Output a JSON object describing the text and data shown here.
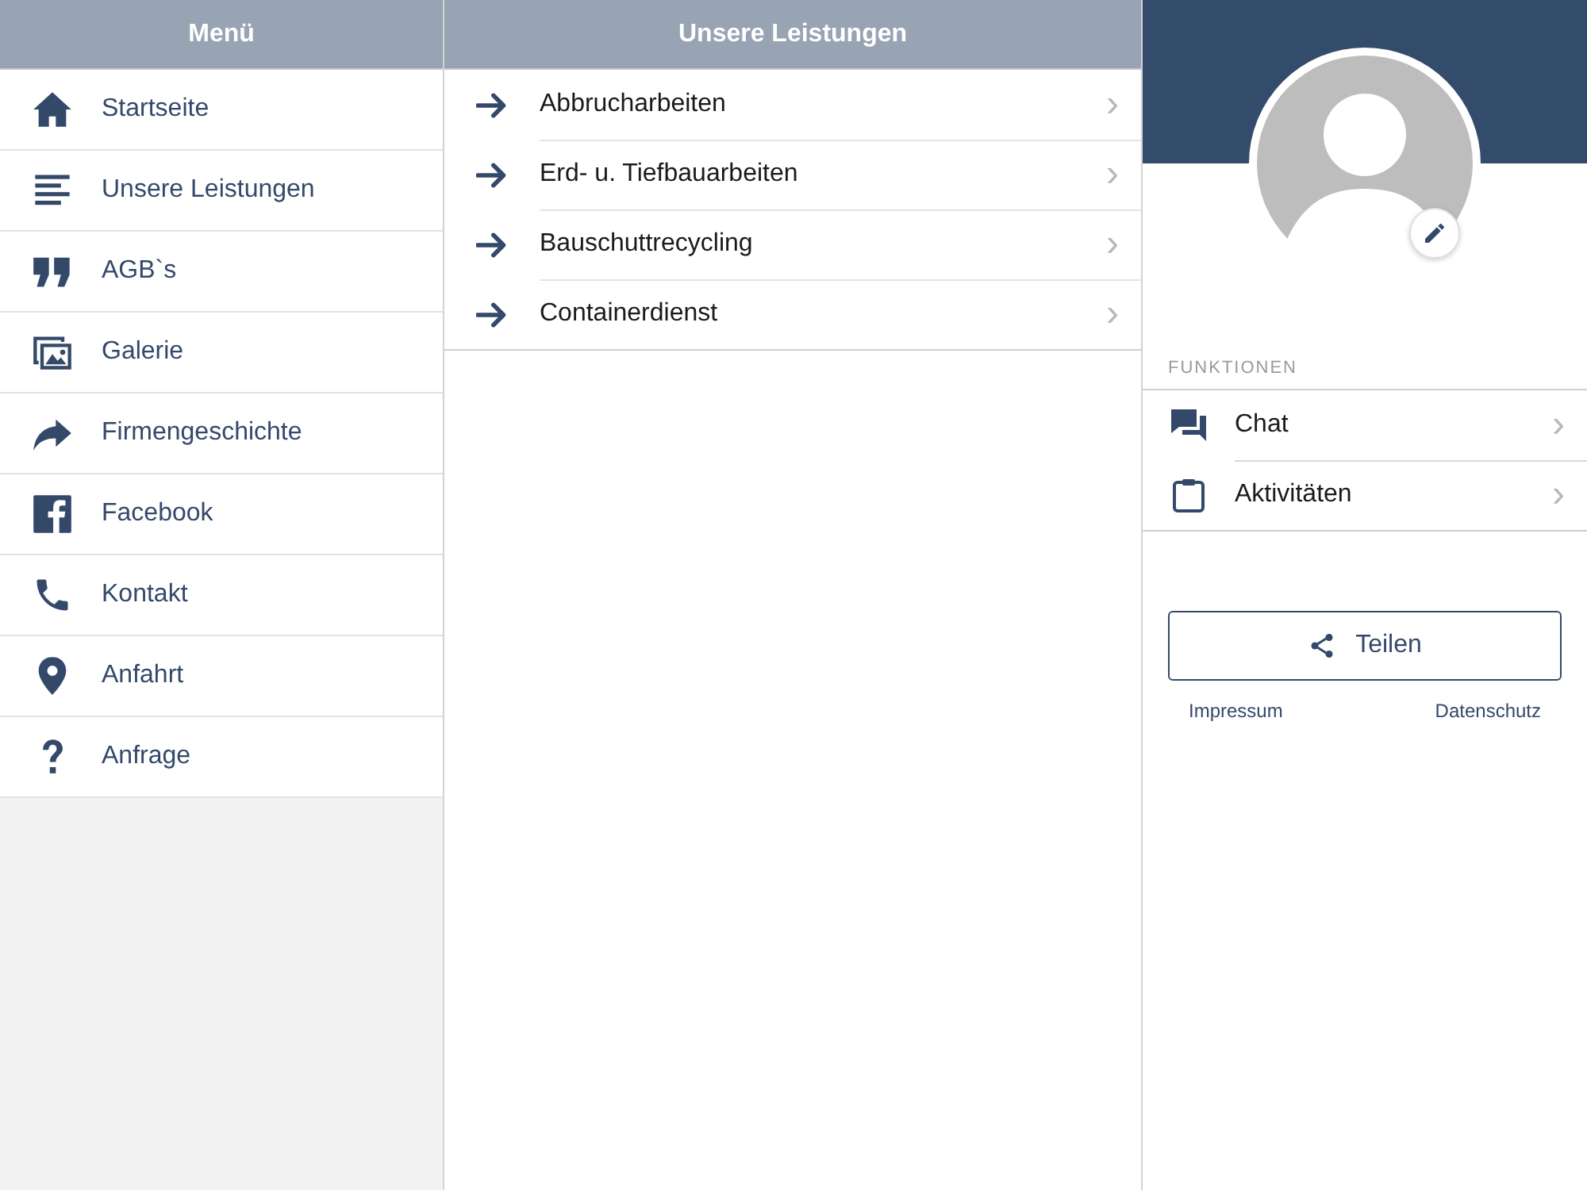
{
  "menu": {
    "title": "Menü",
    "items": [
      {
        "label": "Startseite",
        "kind": "home"
      },
      {
        "label": "Unsere Leistungen",
        "kind": "lines"
      },
      {
        "label": "AGB`s",
        "kind": "quote"
      },
      {
        "label": "Galerie",
        "kind": "gallery"
      },
      {
        "label": "Firmengeschichte",
        "kind": "share"
      },
      {
        "label": "Facebook",
        "kind": "facebook"
      },
      {
        "label": "Kontakt",
        "kind": "phone"
      },
      {
        "label": "Anfahrt",
        "kind": "pin"
      },
      {
        "label": "Anfrage",
        "kind": "question"
      }
    ]
  },
  "services": {
    "title": "Unsere Leistungen",
    "items": [
      {
        "label": "Abbrucharbeiten",
        "chevron": "›"
      },
      {
        "label": "Erd- u. Tiefbauarbeiten",
        "chevron": "›"
      },
      {
        "label": "Bauschuttrecycling",
        "chevron": "›"
      },
      {
        "label": "Containerdienst",
        "chevron": "›"
      }
    ]
  },
  "profile": {
    "section_title": "FUNKTIONEN",
    "functions": [
      {
        "label": "Chat",
        "kind": "chat",
        "chevron": "›"
      },
      {
        "label": "Aktivitäten",
        "kind": "clipboard",
        "chevron": "›"
      }
    ],
    "share_button": "Teilen",
    "links": [
      "Impressum",
      "Datenschutz"
    ]
  }
}
